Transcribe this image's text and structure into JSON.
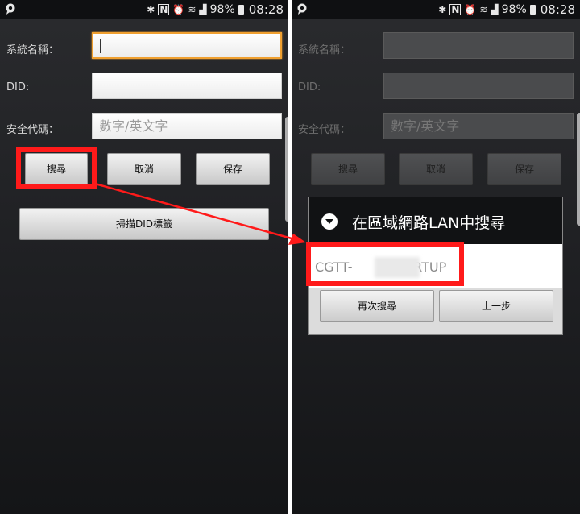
{
  "status_bar": {
    "battery": "98%",
    "time": "08:28",
    "icons": [
      "notification-bubble-icon",
      "bluetooth-icon",
      "nfc-icon",
      "alarm-icon",
      "wifi-icon",
      "signal-icon",
      "battery-icon"
    ]
  },
  "form": {
    "system_name_label": "系統名稱：",
    "system_name_value": "",
    "did_label": "DID:",
    "did_value": "",
    "security_code_label": "安全代碼：",
    "security_code_placeholder": "數字/英文字",
    "search_button": "搜尋",
    "cancel_button": "取消",
    "save_button": "保存",
    "scan_button": "掃描DID標籤"
  },
  "dialog": {
    "title": "在區域網路LAN中搜尋",
    "result_prefix": "CGTT-",
    "result_suffix": "-MRTUP",
    "search_again_button": "再次搜尋",
    "back_button": "上一步"
  },
  "annotation": {
    "highlight_color": "#ff1a1a"
  }
}
